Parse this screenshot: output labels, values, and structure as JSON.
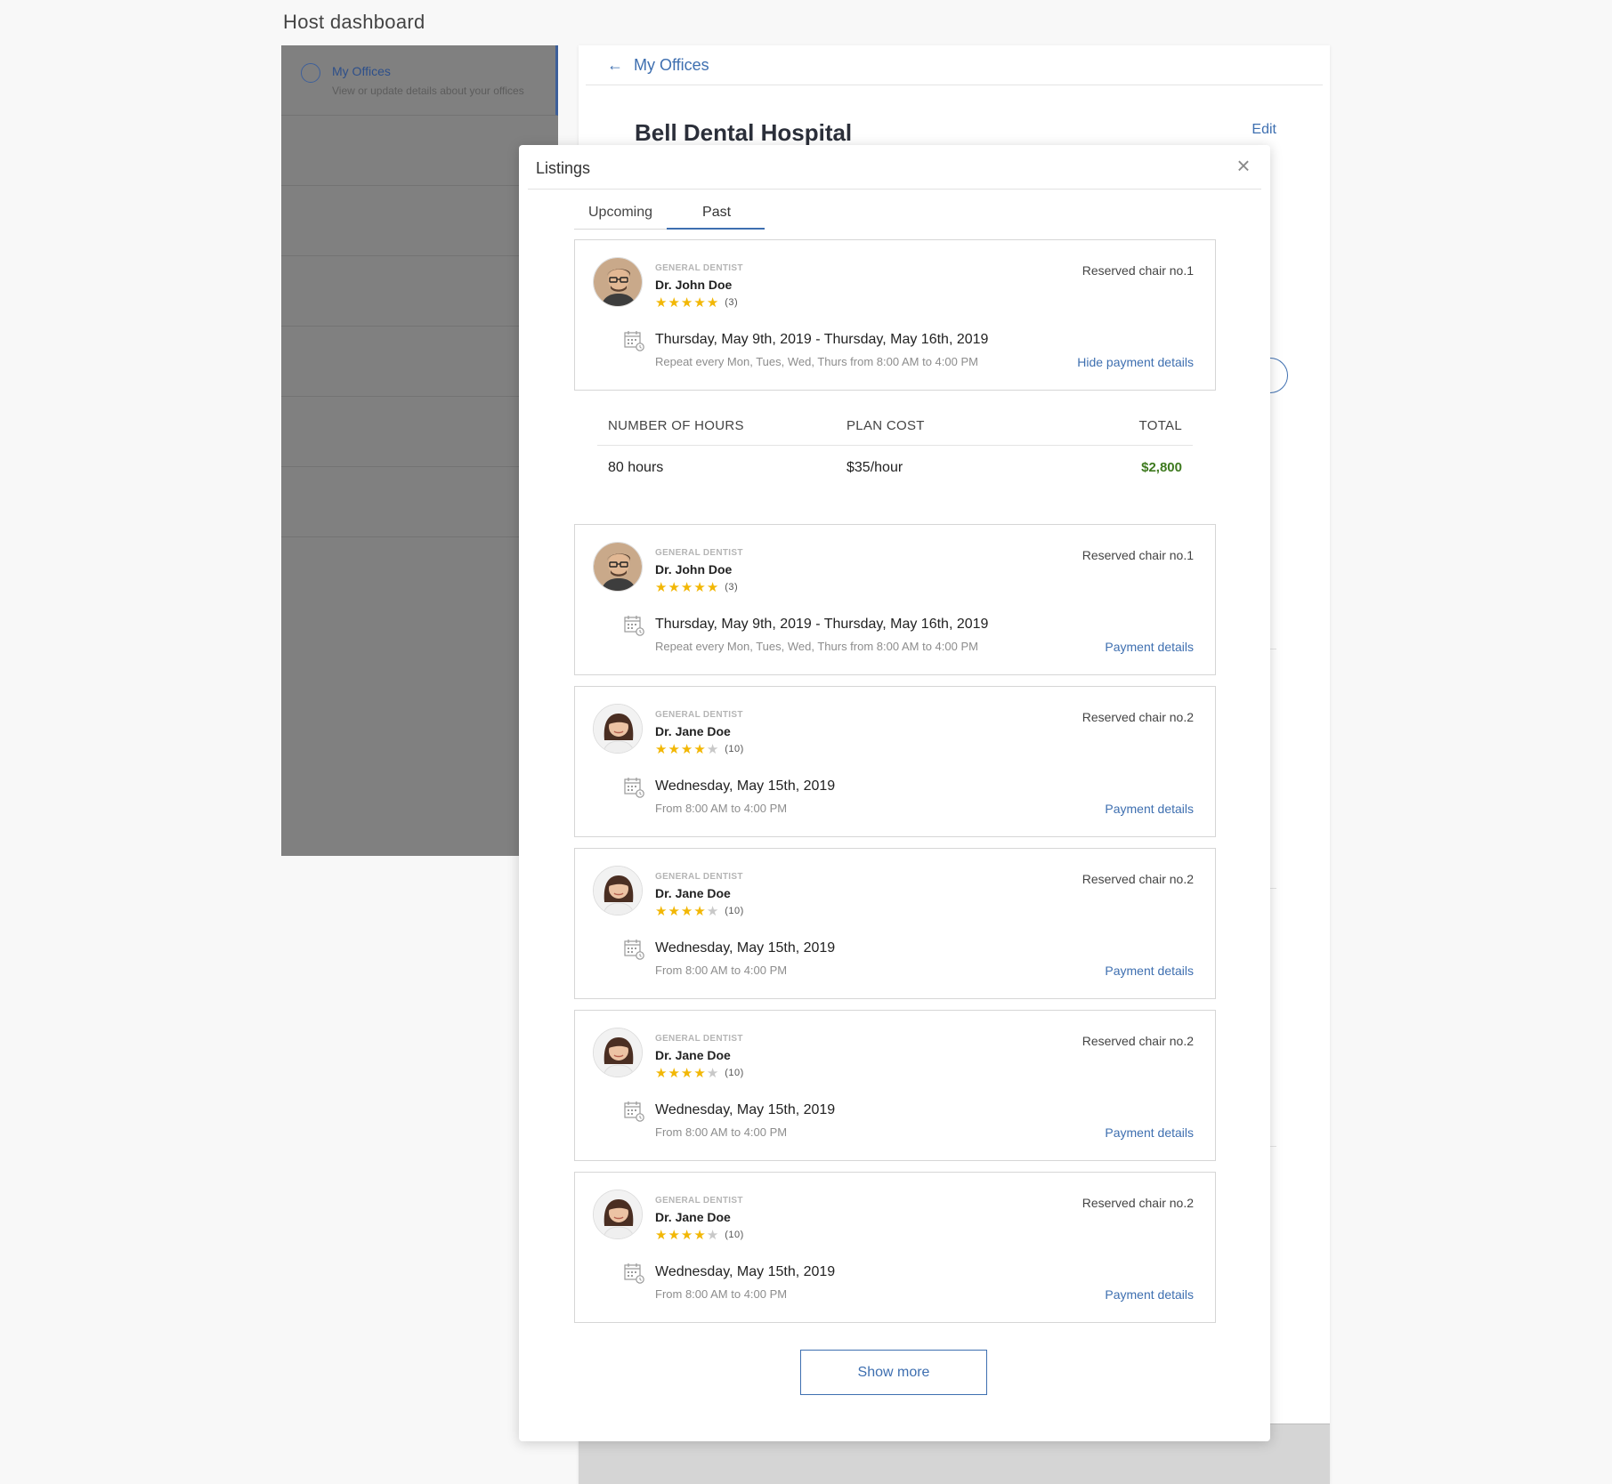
{
  "page": {
    "title": "Host dashboard"
  },
  "sidebar": {
    "items": [
      {
        "label": "My Offices",
        "sub": "View or update details about your offices",
        "active": true
      }
    ]
  },
  "office": {
    "back_label": "My Offices",
    "name": "Bell Dental Hospital",
    "edit_label": "Edit"
  },
  "modal": {
    "title": "Listings",
    "tabs": [
      {
        "label": "Upcoming",
        "active": false
      },
      {
        "label": "Past",
        "active": true
      }
    ],
    "show_more_label": "Show more"
  },
  "listings": [
    {
      "role": "GENERAL DENTIST",
      "name": "Dr. John Doe",
      "rating": 5,
      "reviews": "(3)",
      "chair": "Reserved chair no.1",
      "date": "Thursday, May 9th, 2019 - Thursday, May 16th, 2019",
      "schedule": "Repeat every Mon, Tues, Wed, Thurs from 8:00 AM to 4:00 PM",
      "link": "Hide payment details",
      "avatar": "male"
    },
    {
      "role": "GENERAL DENTIST",
      "name": "Dr. John Doe",
      "rating": 5,
      "reviews": "(3)",
      "chair": "Reserved chair no.1",
      "date": "Thursday, May 9th, 2019 - Thursday, May 16th, 2019",
      "schedule": "Repeat every Mon, Tues, Wed, Thurs from 8:00 AM to 4:00 PM",
      "link": "Payment details",
      "avatar": "male"
    },
    {
      "role": "GENERAL DENTIST",
      "name": "Dr. Jane Doe",
      "rating": 4,
      "reviews": "(10)",
      "chair": "Reserved chair no.2",
      "date": "Wednesday, May 15th, 2019",
      "schedule": "From 8:00 AM to 4:00 PM",
      "link": "Payment details",
      "avatar": "female"
    },
    {
      "role": "GENERAL DENTIST",
      "name": "Dr. Jane Doe",
      "rating": 4,
      "reviews": "(10)",
      "chair": "Reserved chair no.2",
      "date": "Wednesday, May 15th, 2019",
      "schedule": "From 8:00 AM to 4:00 PM",
      "link": "Payment details",
      "avatar": "female"
    },
    {
      "role": "GENERAL DENTIST",
      "name": "Dr. Jane Doe",
      "rating": 4,
      "reviews": "(10)",
      "chair": "Reserved chair no.2",
      "date": "Wednesday, May 15th, 2019",
      "schedule": "From 8:00 AM to 4:00 PM",
      "link": "Payment details",
      "avatar": "female"
    },
    {
      "role": "GENERAL DENTIST",
      "name": "Dr. Jane Doe",
      "rating": 4,
      "reviews": "(10)",
      "chair": "Reserved chair no.2",
      "date": "Wednesday, May 15th, 2019",
      "schedule": "From 8:00 AM to 4:00 PM",
      "link": "Payment details",
      "avatar": "female"
    }
  ],
  "payment_details": {
    "headers": [
      "NUMBER OF HOURS",
      "PLAN COST",
      "TOTAL"
    ],
    "values": [
      "80 hours",
      "$35/hour",
      "$2,800"
    ]
  },
  "colors": {
    "accent": "#3e6fb0",
    "star": "#f2b705",
    "total": "#3e7a1f"
  }
}
